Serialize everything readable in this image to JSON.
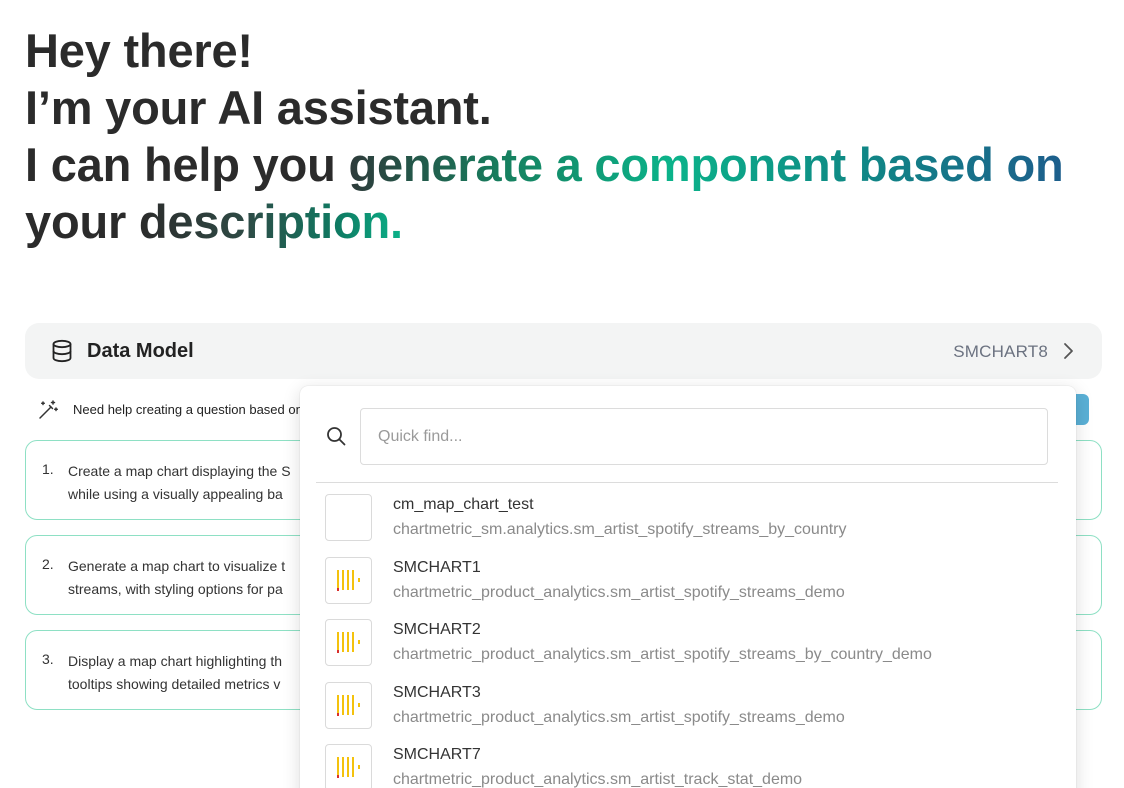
{
  "hero": {
    "line1": "Hey there!",
    "line2": "I’m your AI assistant.",
    "line3_plain": "I can help you ",
    "line3_grad": "generate a component based on",
    "line4_plain": "your ",
    "line4_grad": "description."
  },
  "data_model": {
    "title": "Data Model",
    "selected": "SMCHART8"
  },
  "help": {
    "text": "Need help creating a question based on"
  },
  "suggestions": [
    {
      "num": "1.",
      "line1": "Create a map chart displaying the S",
      "line2": "while using a visually appealing ba"
    },
    {
      "num": "2.",
      "line1": "Generate a map chart to visualize t",
      "line2": "streams, with styling options for pa"
    },
    {
      "num": "3.",
      "line1": "Display a map chart highlighting th",
      "line2": "tooltips showing detailed metrics v"
    }
  ],
  "dropdown": {
    "search_placeholder": "Quick find...",
    "items": [
      {
        "name": "cm_map_chart_test",
        "path": "chartmetric_sm.analytics.sm_artist_spotify_streams_by_country",
        "thumb": "blank"
      },
      {
        "name": "SMCHART1",
        "path": "chartmetric_product_analytics.sm_artist_spotify_streams_demo",
        "thumb": "bars"
      },
      {
        "name": "SMCHART2",
        "path": "chartmetric_product_analytics.sm_artist_spotify_streams_by_country_demo",
        "thumb": "bars"
      },
      {
        "name": "SMCHART3",
        "path": "chartmetric_product_analytics.sm_artist_spotify_streams_demo",
        "thumb": "bars"
      },
      {
        "name": "SMCHART7",
        "path": "chartmetric_product_analytics.sm_artist_track_stat_demo",
        "thumb": "bars"
      }
    ]
  },
  "colors": {
    "accent_teal": "#0bb38a",
    "suggestion_border": "#8ee0c4",
    "help_button": "#5ab0d6",
    "thumb_bar": "#f4c20d",
    "thumb_dot": "#d9302c"
  }
}
